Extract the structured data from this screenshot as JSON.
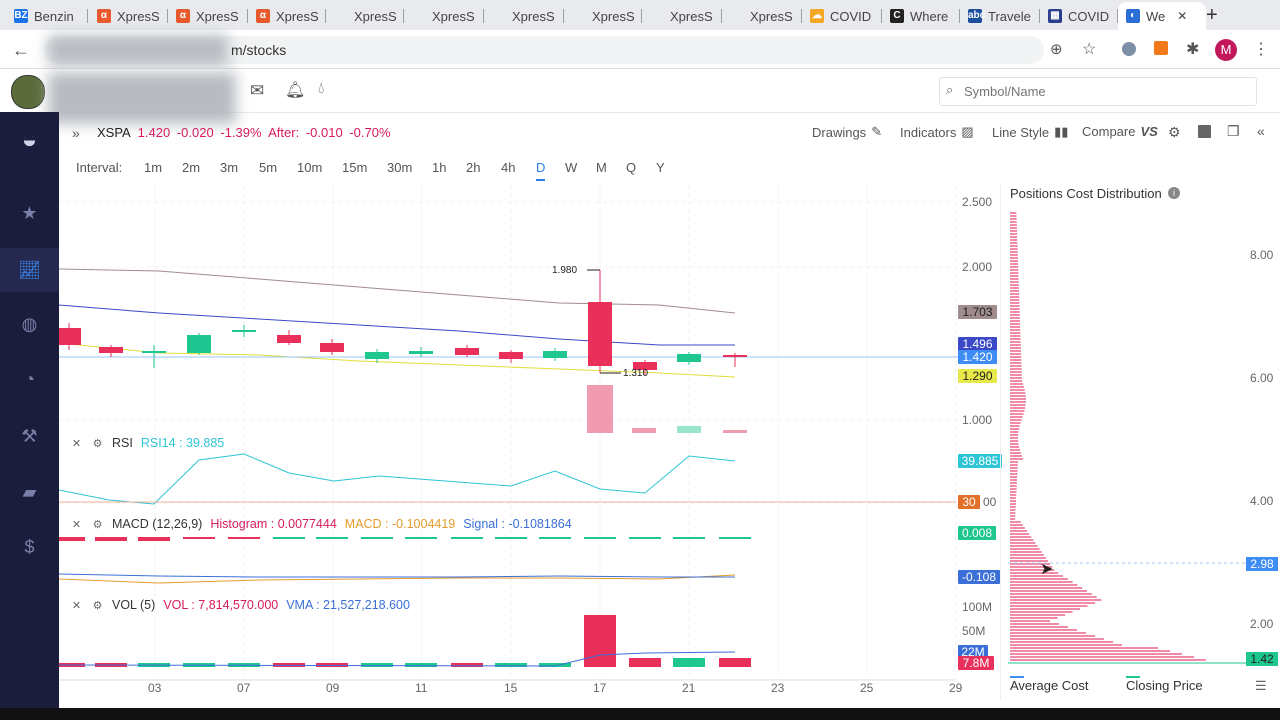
{
  "browser": {
    "tabs": [
      {
        "label": "Benzin",
        "icon": "BZ",
        "color": "#1a73e8"
      },
      {
        "label": "XpresS",
        "icon": "α",
        "color": "#e8592b"
      },
      {
        "label": "XpresS",
        "icon": "α",
        "color": "#e8592b"
      },
      {
        "label": "XpresS",
        "icon": "α",
        "color": "#e8592b"
      },
      {
        "label": "XpresS",
        "icon": "",
        "color": "#e8eaed"
      },
      {
        "label": "XpresS",
        "icon": "",
        "color": "#e8eaed"
      },
      {
        "label": "XpresS",
        "icon": "",
        "color": "#e8eaed"
      },
      {
        "label": "XpresS",
        "icon": "",
        "color": "#e8eaed"
      },
      {
        "label": "XpresS",
        "icon": "",
        "color": "#e8eaed"
      },
      {
        "label": "XpresS",
        "icon": "",
        "color": "#e8eaed"
      },
      {
        "label": "COVID",
        "icon": "☁",
        "color": "#f5a623"
      },
      {
        "label": "Where",
        "icon": "C",
        "color": "#222"
      },
      {
        "label": "Travele",
        "icon": "abc",
        "color": "#1c4e9e"
      },
      {
        "label": "COVID",
        "icon": "▦",
        "color": "#2a3d8f"
      },
      {
        "label": "We",
        "icon": "◐",
        "color": "#2b6fd6"
      }
    ],
    "url": "m/stocks",
    "profile_initial": "M",
    "accent": "#c2185b"
  },
  "header": {
    "search_placeholder": "Symbol/Name"
  },
  "quote": {
    "symbol": "XSPA",
    "price": "1.420",
    "change": "-0.020",
    "change_pct": "-1.39%",
    "after_label": "After:",
    "after_change": "-0.010",
    "after_pct": "-0.70%"
  },
  "toolbar": {
    "drawings": "Drawings",
    "indicators": "Indicators",
    "line_style": "Line Style",
    "compare": "Compare",
    "vs": "VS"
  },
  "intervals": {
    "label": "Interval:",
    "items": [
      "1m",
      "2m",
      "3m",
      "5m",
      "10m",
      "15m",
      "30m",
      "1h",
      "2h",
      "4h",
      "D",
      "W",
      "M",
      "Q",
      "Y"
    ],
    "active": "D"
  },
  "price_axis": [
    "2.500",
    "2.000",
    "1.000"
  ],
  "price_tags": {
    "ma_high": "1.703",
    "ma_mid": "1.496",
    "last": "1.420",
    "ma_low": "1.290"
  },
  "annotations": {
    "high": "1.980",
    "low": "1.310"
  },
  "rsi": {
    "name": "RSI",
    "value_label": "RSI14 : 39.885",
    "tag": "39.885",
    "level_tag": "30",
    "level_axis": "00"
  },
  "macd": {
    "name": "MACD (12,26,9)",
    "histogram": "Histogram : 0.0077444",
    "macd": "MACD : -0.1004419",
    "signal": "Signal : -0.1081864",
    "tag_hist": "0.008",
    "tag_signal": "-0.108"
  },
  "vol": {
    "name": "VOL (5)",
    "vol": "VOL : 7,814,570.000",
    "vma": "VMA : 21,527,218.600",
    "axis": [
      "100M",
      "50M"
    ],
    "tag_vma": "22M",
    "tag_vol": "7.8M"
  },
  "x_axis": [
    "03",
    "07",
    "09",
    "11",
    "15",
    "17",
    "21",
    "23",
    "25",
    "29"
  ],
  "cost_dist": {
    "title": "Positions Cost Distribution",
    "axis": [
      "8.00",
      "6.00",
      "4.00",
      "2.00"
    ],
    "cursor_tag": "2.98",
    "price_tag": "1.42",
    "legend_avg": "Average Cost",
    "legend_close": "Closing Price"
  },
  "colors": {
    "up": "#1fc690",
    "down": "#e8305a",
    "brand_dark": "#1b1d3d"
  }
}
